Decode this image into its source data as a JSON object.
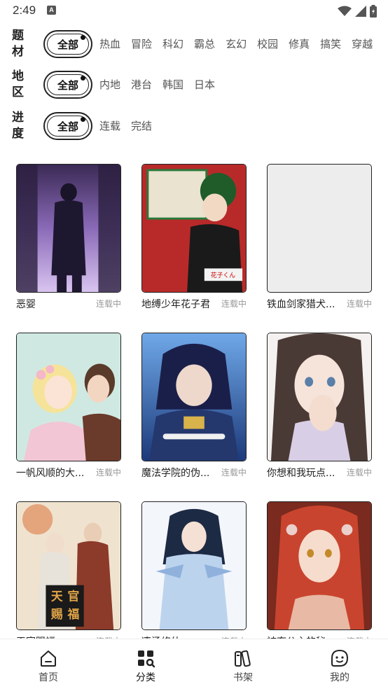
{
  "status_bar": {
    "time": "2:49",
    "notification_icon": "a-icon",
    "icons": [
      "wifi-icon",
      "signal-icon",
      "battery-icon"
    ]
  },
  "filters": [
    {
      "title": "题材",
      "selected": "全部",
      "options": [
        "热血",
        "冒险",
        "科幻",
        "霸总",
        "玄幻",
        "校园",
        "修真",
        "搞笑",
        "穿越"
      ]
    },
    {
      "title": "地区",
      "selected": "全部",
      "options": [
        "内地",
        "港台",
        "韩国",
        "日本"
      ]
    },
    {
      "title": "进度",
      "selected": "全部",
      "options": [
        "连载",
        "完结"
      ]
    }
  ],
  "comics": [
    {
      "title": "恶婴",
      "status": "连载中"
    },
    {
      "title": "地缚少年花子君",
      "status": "连载中"
    },
    {
      "title": "铁血剑家猎犬...",
      "status": "连载中"
    },
    {
      "title": "一帆风顺的大...",
      "status": "连载中"
    },
    {
      "title": "魔法学院的伪...",
      "status": "连载中"
    },
    {
      "title": "你想和我玩点...",
      "status": "连载中"
    },
    {
      "title": "天官赐福",
      "status": "连载中"
    },
    {
      "title": "凄汤修仙",
      "status": "连载中"
    },
    {
      "title": "被弃公主的秘...",
      "status": "连载中"
    }
  ],
  "cover_art": {
    "tiankan_logo_text": [
      "天",
      "官",
      "赐",
      "福"
    ],
    "hanako_logo_text": "花子くん"
  },
  "nav": [
    {
      "label": "首页",
      "icon": "home-icon",
      "active": false
    },
    {
      "label": "分类",
      "icon": "category-icon",
      "active": true
    },
    {
      "label": "书架",
      "icon": "bookshelf-icon",
      "active": false
    },
    {
      "label": "我的",
      "icon": "profile-icon",
      "active": false
    }
  ],
  "colors": {
    "accent": "#111111",
    "muted_text": "#999999",
    "option_text": "#555555"
  }
}
